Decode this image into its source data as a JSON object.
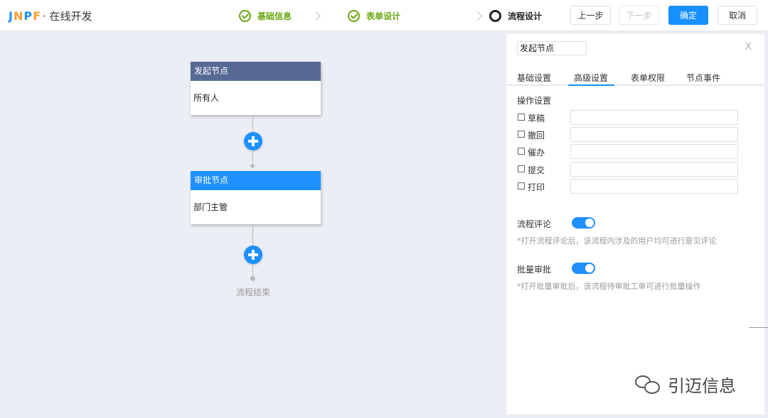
{
  "header": {
    "logo_mark": [
      "J",
      "N",
      "P",
      "F"
    ],
    "logo_text": "· 在线开发",
    "steps": [
      {
        "label": "基础信息",
        "state": "done"
      },
      {
        "label": "表单设计",
        "state": "done"
      },
      {
        "label": "流程设计",
        "state": "active"
      }
    ],
    "buttons": {
      "prev": "上一步",
      "next": "下一步",
      "confirm": "确定",
      "cancel": "取消"
    }
  },
  "canvas": {
    "start_node": {
      "title": "发起节点",
      "body": "所有人"
    },
    "approve_node": {
      "title": "审批节点",
      "body": "部门主管"
    },
    "end_label": "流程结束"
  },
  "panel": {
    "node_name": "发起节点",
    "close": "X",
    "tabs": [
      "基础设置",
      "高级设置",
      "表单权限",
      "节点事件"
    ],
    "active_tab": "高级设置",
    "operation_title": "操作设置",
    "operations": [
      {
        "label": "草稿",
        "checked": false,
        "value": ""
      },
      {
        "label": "撤回",
        "checked": false,
        "value": ""
      },
      {
        "label": "催办",
        "checked": false,
        "value": ""
      },
      {
        "label": "提交",
        "checked": false,
        "value": ""
      },
      {
        "label": "打印",
        "checked": false,
        "value": ""
      }
    ],
    "comment": {
      "label": "流程评论",
      "enabled": true,
      "hint": "*打开流程评论后，该流程内涉及的用户均可进行意见评论"
    },
    "batch": {
      "label": "批量审批",
      "enabled": true,
      "hint": "*打开批量审批后，该流程待审批工单可进行批量操作"
    }
  },
  "watermark": {
    "text": "引迈信息"
  },
  "colors": {
    "primary": "#1890ff",
    "start_node_header": "#576a95",
    "approve_node_header": "#1e90ff",
    "step_done": "#67a70f",
    "canvas_bg": "#eceef5"
  }
}
